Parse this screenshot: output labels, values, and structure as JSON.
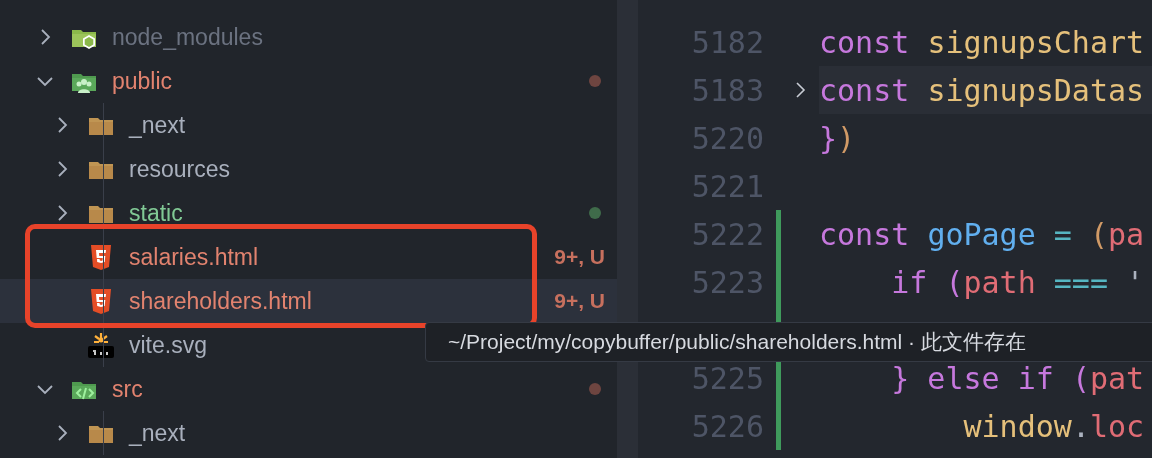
{
  "explorer": {
    "items": [
      {
        "label": "node_modules",
        "kind": "nodefolder",
        "expanded": false,
        "color": "#6b7280",
        "selected": false
      },
      {
        "label": "public",
        "kind": "publicfolder",
        "expanded": true,
        "color": "#e2836f",
        "dot": {
          "color": "#6e4540"
        },
        "selected": false,
        "children": [
          {
            "label": "_next",
            "kind": "folder",
            "expanded": false,
            "color": "#a9b0bd",
            "selected": false
          },
          {
            "label": "resources",
            "kind": "folder",
            "expanded": false,
            "color": "#a9b0bd",
            "selected": false
          },
          {
            "label": "static",
            "kind": "folder",
            "expanded": false,
            "color": "#81c995",
            "dot": {
              "color": "#3f6b4a"
            },
            "selected": false
          },
          {
            "label": "salaries.html",
            "kind": "html",
            "color": "#e2836f",
            "badge": "9+, U",
            "selected": false
          },
          {
            "label": "shareholders.html",
            "kind": "html",
            "color": "#e2836f",
            "badge": "9+, U",
            "selected": true
          },
          {
            "label": "vite.svg",
            "kind": "svg",
            "color": "#a9b0bd",
            "selected": false
          }
        ]
      },
      {
        "label": "src",
        "kind": "srcfolder",
        "expanded": true,
        "color": "#e2836f",
        "dot": {
          "color": "#6e4540"
        },
        "selected": false,
        "children": [
          {
            "label": "_next",
            "kind": "folder",
            "expanded": false,
            "color": "#a9b0bd",
            "selected": false
          }
        ]
      }
    ]
  },
  "editor": {
    "lines": [
      {
        "number": "5182",
        "folded": false,
        "changed": false,
        "tokens": [
          {
            "t": "const ",
            "color": "#c678dd"
          },
          {
            "t": "signupsChart",
            "color": "#e5c07b"
          }
        ]
      },
      {
        "number": "5183",
        "folded": true,
        "changed": false,
        "tokens": [
          {
            "t": "const ",
            "color": "#c678dd"
          },
          {
            "t": "signupsDatas",
            "color": "#e5c07b"
          }
        ]
      },
      {
        "number": "5220",
        "folded": false,
        "changed": false,
        "tokens": [
          {
            "t": "}",
            "color": "#c678dd"
          },
          {
            "t": ")",
            "color": "#d19a66"
          }
        ]
      },
      {
        "number": "5221",
        "folded": false,
        "changed": false
      },
      {
        "number": "5222",
        "folded": false,
        "changed": true,
        "tokens": [
          {
            "t": "const ",
            "color": "#c678dd"
          },
          {
            "t": "goPage",
            "color": "#61afef"
          },
          {
            "t": " = ",
            "color": "#56b6c2"
          },
          {
            "t": "(",
            "color": "#d19a66"
          },
          {
            "t": "pa",
            "color": "#e06c75"
          }
        ]
      },
      {
        "number": "5223",
        "folded": false,
        "changed": true,
        "tokens": [
          {
            "t": "    if ",
            "color": "#c678dd"
          },
          {
            "t": "(",
            "color": "#c678dd"
          },
          {
            "t": "path",
            "color": "#e06c75"
          },
          {
            "t": " === ",
            "color": "#56b6c2"
          },
          {
            "t": "'",
            "color": "#abb2bf"
          }
        ]
      },
      {
        "folded": false,
        "changed": true
      },
      {
        "number": "5225",
        "folded": false,
        "changed": true,
        "tokens": [
          {
            "t": "    } else if ",
            "color": "#c678dd"
          },
          {
            "t": "(",
            "color": "#c678dd"
          },
          {
            "t": "pat",
            "color": "#e06c75"
          }
        ]
      },
      {
        "number": "5226",
        "folded": false,
        "changed": true,
        "tokens": [
          {
            "t": "        window",
            "color": "#e5c07b"
          },
          {
            "t": ".",
            "color": "#abb2bf"
          },
          {
            "t": "loc",
            "color": "#e06c75"
          }
        ]
      }
    ]
  },
  "tooltip": {
    "text": "~/Project/my/copybuffer/public/shareholders.html · 此文件存在"
  }
}
